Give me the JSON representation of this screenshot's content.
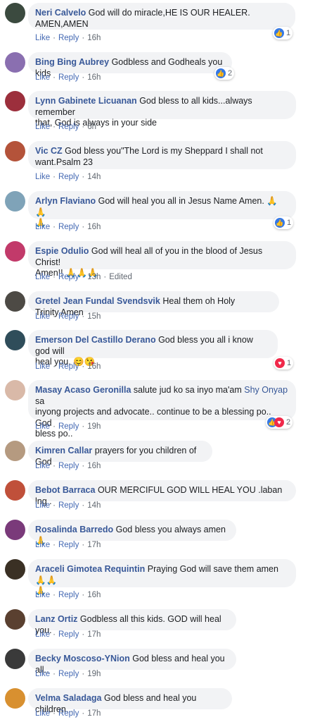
{
  "labels": {
    "like": "Like",
    "reply": "Reply",
    "sep": "·",
    "edited": "Edited"
  },
  "colors": {
    "name": "#385898",
    "link": "#4267b2",
    "bubble": "#f2f3f5",
    "like": "#3578e5",
    "love": "#f0284a"
  },
  "comments": [
    {
      "author": "Neri Calvelo",
      "text_1": "God will do miracle,HE IS OUR HEALER.",
      "text_2": "AMEN,AMEN",
      "time": "16h",
      "reaction_count": "1",
      "avatar_color": "#3b4a3f"
    },
    {
      "author": "Bing Bing Aubrey",
      "text_1": "Godbless and Godheals you kids",
      "time": "16h",
      "reaction_count": "2",
      "avatar_color": "#8a6fb0"
    },
    {
      "author": "Lynn Gabinete Licuanan",
      "text_1": "God bless to all kids...always remember",
      "text_2": "that, God is always in your side",
      "time": "6h",
      "avatar_color": "#9c2f3c"
    },
    {
      "author": "Vic CZ",
      "text_1": "God bless you\"The Lord is my Sheppard I shall not",
      "text_2": "want.Psalm 23",
      "time": "14h",
      "avatar_color": "#b4533a"
    },
    {
      "author": "Arlyn Flaviano",
      "text_1": "God will heal you all in Jesus Name Amen. 🙏🙏",
      "text_2": "🙏",
      "time": "16h",
      "reaction_count": "1",
      "avatar_color": "#7fa3b8"
    },
    {
      "author": "Espie Odulio",
      "text_1": "God will heal all of you in the blood of Jesus Christ!",
      "text_2": "Amen!! 🙏🙏🙏",
      "time": "13h",
      "edited": true,
      "avatar_color": "#c23a6a"
    },
    {
      "author": "Gretel Jean Fundal Svendsvik",
      "text_1": "Heal them oh Holy Trinity.Amen",
      "time": "15h",
      "avatar_color": "#4d4a45"
    },
    {
      "author": "Emerson Del Castillo Derano",
      "text_1": "God bless you all i know god will",
      "text_2": "heal you. 😊😘",
      "time": "16h",
      "reaction_count": "1",
      "avatar_color": "#2f4d5a"
    },
    {
      "author": "Masay Acaso Geronilla",
      "text_1": "salute jud ko sa inyo ma'am",
      "mention": "Shy Onyap",
      "text_1b": "sa",
      "text_2": "inyong projects and advocate.. continue to be a blessing po.. God",
      "text_3": "bless po..",
      "time": "19h",
      "reaction_count": "2",
      "avatar_color": "#d9b9a8"
    },
    {
      "author": "Kimren Callar",
      "text_1": "prayers for you children of God",
      "time": "16h",
      "avatar_color": "#b59a80"
    },
    {
      "author": "Bebot Barraca",
      "text_1": "OUR MERCIFUL GOD WILL HEAL YOU .laban lng .",
      "time": "14h",
      "avatar_color": "#c0503a"
    },
    {
      "author": "Rosalinda Barredo",
      "text_1": "God bless you always amen 🙏",
      "time": "17h",
      "avatar_color": "#7a3a7a"
    },
    {
      "author": "Araceli Gimotea Requintin",
      "text_1": "Praying God will save them amen🙏🙏",
      "text_2": "🙏",
      "time": "16h",
      "avatar_color": "#3a3024"
    },
    {
      "author": "Lanz Ortiz",
      "text_1": "Godbless all this kids. GOD will heal you.",
      "time": "17h",
      "avatar_color": "#5a4030"
    },
    {
      "author": "Becky Moscoso-YNion",
      "text_1": "God bless and heal you all..",
      "time": "19h",
      "avatar_color": "#3a3a3a"
    },
    {
      "author": "Velma Saladaga",
      "text_1": "God bless and heal you children...",
      "time": "17h",
      "avatar_color": "#d89030"
    }
  ]
}
